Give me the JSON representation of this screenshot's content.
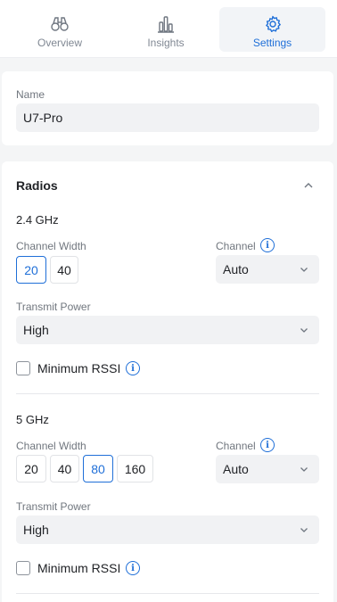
{
  "tabs": [
    {
      "label": "Overview",
      "icon": "binoculars-icon",
      "active": false
    },
    {
      "label": "Insights",
      "icon": "bar-chart-icon",
      "active": false
    },
    {
      "label": "Settings",
      "icon": "gear-icon",
      "active": true
    }
  ],
  "name_card": {
    "label": "Name",
    "value": "U7-Pro"
  },
  "radios": {
    "title": "Radios",
    "band_24": {
      "title": "2.4 GHz",
      "channel_width_label": "Channel Width",
      "widths": [
        "20",
        "40"
      ],
      "selected_width": "20",
      "channel_label": "Channel",
      "channel_value": "Auto",
      "transmit_power_label": "Transmit Power",
      "transmit_power_value": "High",
      "min_rssi_label": "Minimum RSSI"
    },
    "band_5": {
      "title": "5 GHz",
      "channel_width_label": "Channel Width",
      "widths": [
        "20",
        "40",
        "80",
        "160"
      ],
      "selected_width": "80",
      "channel_label": "Channel",
      "channel_value": "Auto",
      "transmit_power_label": "Transmit Power",
      "transmit_power_value": "High",
      "min_rssi_label": "Minimum RSSI"
    }
  },
  "colors": {
    "accent": "#1f6fd8",
    "background": "#f4f5f6",
    "field": "#f1f2f4"
  }
}
